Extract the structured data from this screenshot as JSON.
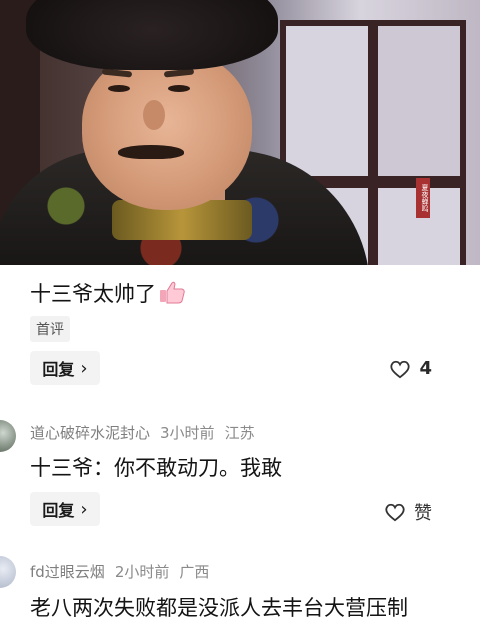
{
  "hero": {
    "seal_text": "夏夜蝉鸣"
  },
  "comments": [
    {
      "text": "十三爷太帅了",
      "badge": "首评",
      "reply_label": "回复",
      "like_count": "4"
    },
    {
      "username": "道心破碎水泥封心",
      "time": "3小时前",
      "location": "江苏",
      "text": "十三爷：你不敢动刀。我敢",
      "reply_label": "回复",
      "like_label": "赞"
    },
    {
      "username": "fd过眼云烟",
      "time": "2小时前",
      "location": "广西",
      "text": "老八两次失败都是没派人去丰台大营压制"
    }
  ],
  "icons": {
    "thumbs_up": "thumbs-up-emoji",
    "heart": "heart-outline-icon",
    "chevron": "chevron-right-icon"
  }
}
